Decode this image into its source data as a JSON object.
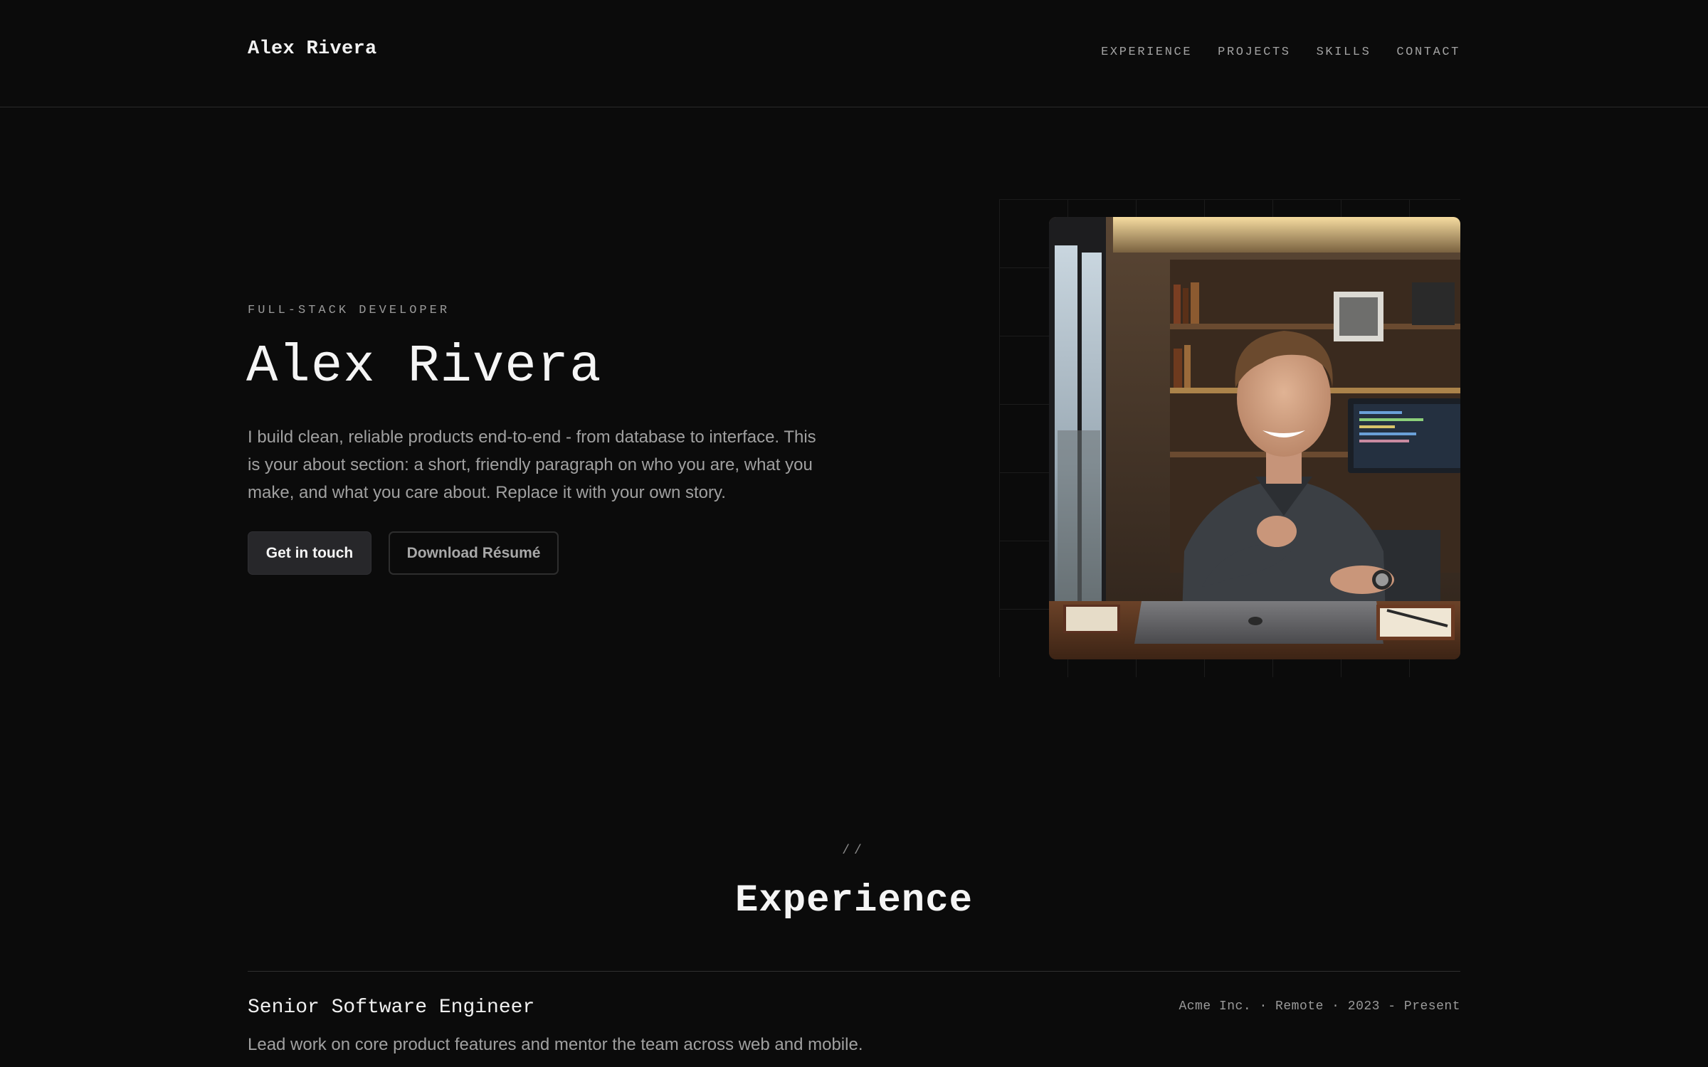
{
  "header": {
    "brand": "Alex Rivera",
    "nav": [
      {
        "label": "EXPERIENCE"
      },
      {
        "label": "PROJECTS"
      },
      {
        "label": "SKILLS"
      },
      {
        "label": "CONTACT"
      }
    ]
  },
  "hero": {
    "eyebrow": "FULL-STACK DEVELOPER",
    "title": "Alex Rivera",
    "description": "I build clean, reliable products end-to-end - from database to interface. This is your about section: a short, friendly paragraph on who you are, what you make, and what you care about. Replace it with your own story.",
    "primary_button": "Get in touch",
    "secondary_button": "Download Résumé",
    "portrait_alt": "portrait photo"
  },
  "experience": {
    "marker": "//",
    "title": "Experience",
    "jobs": [
      {
        "title": "Senior Software Engineer",
        "meta": "Acme Inc. · Remote · 2023 - Present",
        "description": "Lead work on core product features and mentor the team across web and mobile."
      }
    ]
  },
  "colors": {
    "background": "#0b0b0b",
    "primary_button_bg": "#27272a",
    "muted_text": "#a0a0a0"
  }
}
